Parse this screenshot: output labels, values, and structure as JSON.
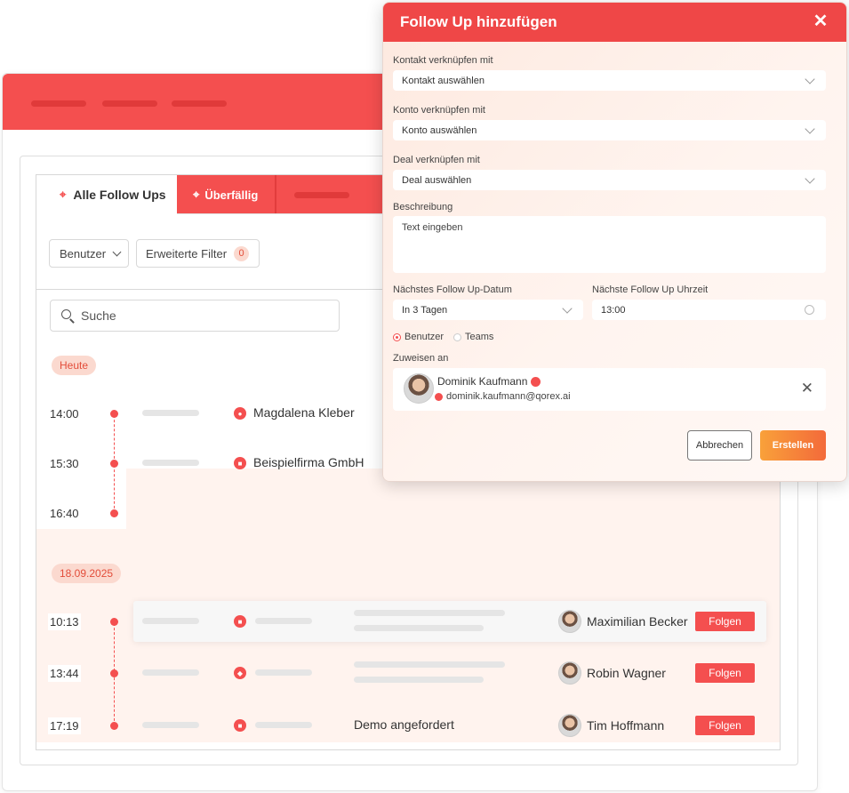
{
  "modal": {
    "title": "Follow Up hinzufügen",
    "contact_label": "Kontakt verknüpfen mit",
    "contact_placeholder": "Kontakt auswählen",
    "account_label": "Konto verknüpfen mit",
    "account_placeholder": "Konto auswählen",
    "deal_label": "Deal verknüpfen mit",
    "deal_placeholder": "Deal auswählen",
    "description_label": "Beschreibung",
    "description_placeholder": "Text eingeben",
    "next_date_label": "Nächstes Follow Up-Datum",
    "next_date_value": "In 3 Tagen",
    "next_time_label": "Nächste Follow Up Uhrzeit",
    "next_time_value": "13:00",
    "radio_user": "Benutzer",
    "radio_teams": "Teams",
    "assign_label": "Zuweisen an",
    "assignee_name": "Dominik Kaufmann",
    "assignee_email": "dominik.kaufmann@qorex.ai",
    "cancel_label": "Abbrechen",
    "create_label": "Erstellen"
  },
  "tabs": {
    "all": "Alle Follow Ups",
    "overdue": "Überfällig"
  },
  "filters": {
    "user": "Benutzer",
    "advanced": "Erweiterte Filter",
    "advanced_count": "0"
  },
  "search": {
    "placeholder": "Suche"
  },
  "groups": {
    "today": "Heute",
    "date2": "18.09.2025"
  },
  "today_items": [
    {
      "time": "14:00",
      "name": "Magdalena Kleber"
    },
    {
      "time": "15:30",
      "name": "Beispielfirma GmbH"
    },
    {
      "time": "16:40"
    }
  ],
  "date2_items": [
    {
      "time": "10:13",
      "person": "Maximilian Becker",
      "action": "Folgen"
    },
    {
      "time": "13:44",
      "person": "Robin Wagner",
      "action": "Folgen"
    },
    {
      "time": "17:19",
      "note": "Demo angefordert",
      "person": "Tim Hoffmann",
      "action": "Folgen"
    }
  ],
  "colors": {
    "accent": "#f44f4f",
    "create_gradient_start": "#f9a13a",
    "create_gradient_end": "#f36a3a"
  }
}
